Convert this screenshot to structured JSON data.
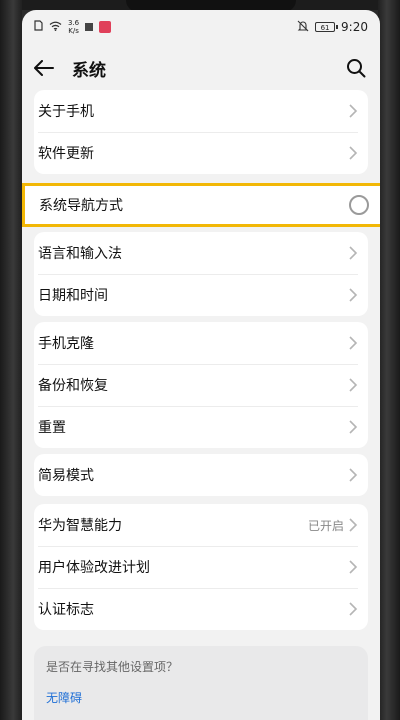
{
  "status": {
    "net_speed_value": "3.6",
    "net_speed_unit": "K/s",
    "battery": "61",
    "time": "9:20"
  },
  "header": {
    "title": "系统"
  },
  "group1": [
    {
      "label": "关于手机"
    },
    {
      "label": "软件更新"
    }
  ],
  "nav_row": {
    "label": "系统导航方式"
  },
  "group2": [
    {
      "label": "语言和输入法"
    },
    {
      "label": "日期和时间"
    }
  ],
  "group3": [
    {
      "label": "手机克隆"
    },
    {
      "label": "备份和恢复"
    },
    {
      "label": "重置"
    }
  ],
  "group4": [
    {
      "label": "简易模式"
    }
  ],
  "group5": [
    {
      "label": "华为智慧能力",
      "value": "已开启"
    },
    {
      "label": "用户体验改进计划"
    },
    {
      "label": "认证标志"
    }
  ],
  "suggest": {
    "question": "是否在寻找其他设置项？",
    "link": "无障碍"
  },
  "colors": {
    "highlight": "#f2b705",
    "link": "#1f6fd6"
  }
}
